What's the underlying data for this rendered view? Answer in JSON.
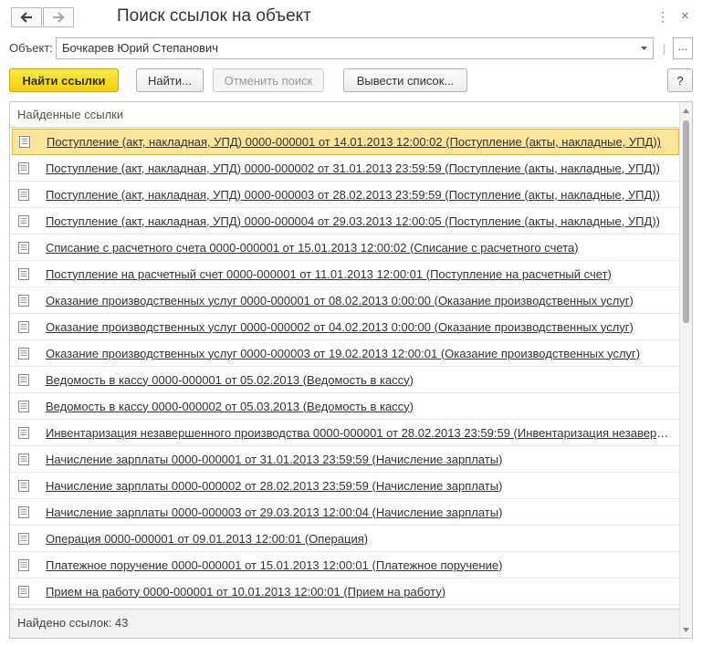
{
  "window": {
    "title": "Поиск ссылок на объект",
    "more_icon": "more-vertical-icon",
    "close_icon": "close-icon"
  },
  "object": {
    "label": "Объект:",
    "value": "Бочкарев Юрий Степанович",
    "open_label": "..."
  },
  "toolbar": {
    "find_links": "Найти ссылки",
    "find": "Найти...",
    "cancel_search": "Отменить поиск",
    "output_list": "Вывести список...",
    "help": "?"
  },
  "list": {
    "header": "Найденные ссылки",
    "items": [
      "Поступление (акт, накладная, УПД) 0000-000001 от 14.01.2013 12:00:02 (Поступление (акты, накладные, УПД))",
      "Поступление (акт, накладная, УПД) 0000-000002 от 31.01.2013 23:59:59 (Поступление (акты, накладные, УПД))",
      "Поступление (акт, накладная, УПД) 0000-000003 от 28.02.2013 23:59:59 (Поступление (акты, накладные, УПД))",
      "Поступление (акт, накладная, УПД) 0000-000004 от 29.03.2013 12:00:05 (Поступление (акты, накладные, УПД))",
      "Списание с расчетного счета 0000-000001 от 15.01.2013 12:00:02 (Списание с расчетного счета)",
      "Поступление на расчетный счет 0000-000001 от 11.01.2013 12:00:01 (Поступление на расчетный счет)",
      "Оказание производственных услуг 0000-000001 от 08.02.2013 0:00:00 (Оказание производственных услуг)",
      "Оказание производственных услуг 0000-000002 от 04.02.2013 0:00:00 (Оказание производственных услуг)",
      "Оказание производственных услуг 0000-000003 от 19.02.2013 12:00:01 (Оказание производственных услуг)",
      "Ведомость в кассу 0000-000001 от 05.02.2013 (Ведомость в кассу)",
      "Ведомость в кассу 0000-000002 от 05.03.2013 (Ведомость в кассу)",
      "Инвентаризация незавершенного производства 0000-000001 от 28.02.2013 23:59:59 (Инвентаризация незаверше...",
      "Начисление зарплаты 0000-000001 от 31.01.2013 23:59:59 (Начисление зарплаты)",
      "Начисление зарплаты 0000-000002 от 28.02.2013 23:59:59 (Начисление зарплаты)",
      "Начисление зарплаты 0000-000003 от 29.03.2013 12:00:04 (Начисление зарплаты)",
      "Операция 0000-000001 от 09.01.2013 12:00:01 (Операция)",
      "Платежное поручение 0000-000001 от 15.01.2013 12:00:01 (Платежное поручение)",
      "Прием на работу 0000-000001 от 10.01.2013 12:00:01 (Прием на работу)"
    ],
    "selected_index": 0,
    "footer": "Найдено ссылок: 43"
  },
  "colors": {
    "primary_button": "#f5d31a",
    "selection": "#fbe49b"
  }
}
